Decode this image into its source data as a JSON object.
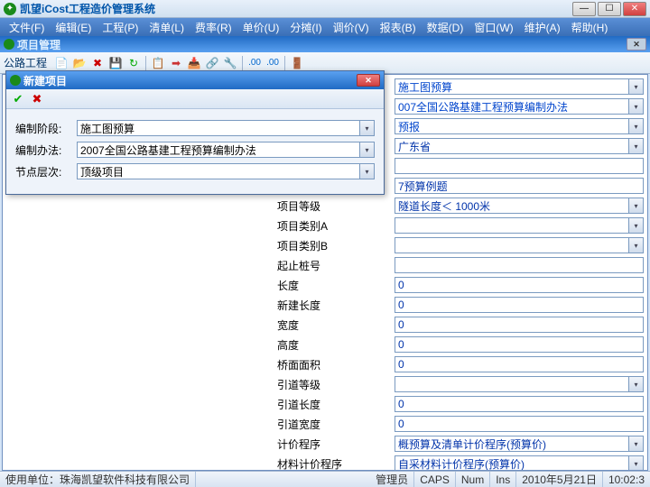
{
  "window": {
    "title": "凯望iCost工程造价管理系统",
    "sub_title": "项目管理"
  },
  "menu": [
    "文件(F)",
    "编辑(E)",
    "工程(P)",
    "清单(L)",
    "费率(R)",
    "单价(U)",
    "分摊(I)",
    "调价(V)",
    "报表(B)",
    "数据(D)",
    "窗口(W)",
    "维护(A)",
    "帮助(H)"
  ],
  "toolbar": {
    "label": "公路工程"
  },
  "dialog": {
    "title": "新建项目",
    "rows": [
      {
        "label": "编制阶段:",
        "value": "施工图预算"
      },
      {
        "label": "编制办法:",
        "value": "2007全国公路基建工程预算编制办法"
      },
      {
        "label": "节点层次:",
        "value": "顶级项目"
      }
    ]
  },
  "form": [
    {
      "label": "",
      "value": "施工图预算",
      "combo": true,
      "blue": true
    },
    {
      "label": "",
      "value": "007全国公路基建工程预算编制办法",
      "combo": true,
      "blue": true
    },
    {
      "label": "",
      "value": "预报",
      "combo": true,
      "blue": true
    },
    {
      "label": "",
      "value": "广东省",
      "combo": true
    },
    {
      "label": "",
      "value": "",
      "combo": false
    },
    {
      "label": "",
      "value": "7预算例题",
      "combo": false
    },
    {
      "label": "项目等级",
      "value": "隧道长度＜ 1000米",
      "combo": true
    },
    {
      "label": "项目类别A",
      "value": "",
      "combo": true
    },
    {
      "label": "项目类别B",
      "value": "",
      "combo": true
    },
    {
      "label": "起止桩号",
      "value": "",
      "combo": false
    },
    {
      "label": "长度",
      "value": "0",
      "combo": false
    },
    {
      "label": "新建长度",
      "value": "0",
      "combo": false
    },
    {
      "label": "宽度",
      "value": "0",
      "combo": false
    },
    {
      "label": "高度",
      "value": "0",
      "combo": false
    },
    {
      "label": "桥面面积",
      "value": "0",
      "combo": false
    },
    {
      "label": "引道等级",
      "value": "",
      "combo": true
    },
    {
      "label": "引道长度",
      "value": "0",
      "combo": false
    },
    {
      "label": "引道宽度",
      "value": "0",
      "combo": false
    },
    {
      "label": "计价程序",
      "value": "概预算及清单计价程序(预算价)",
      "combo": true
    },
    {
      "label": "材料计价程序",
      "value": "自采材料计价程序(预算价)",
      "combo": true
    }
  ],
  "status": {
    "org": "使用单位：珠海凯望软件科技有限公司",
    "user": "管理员",
    "caps": "CAPS",
    "num": "Num",
    "ins": "Ins",
    "date": "2010年5月21日",
    "time": "10:02:3"
  }
}
